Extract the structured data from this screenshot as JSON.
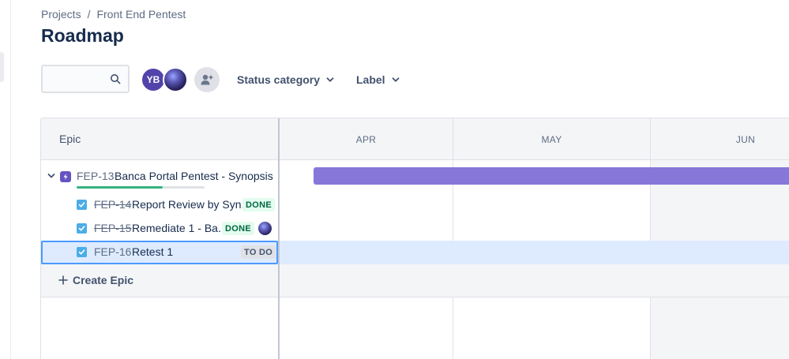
{
  "breadcrumb": {
    "projects": "Projects",
    "separator": "/",
    "project": "Front End Pentest"
  },
  "page": {
    "title": "Roadmap"
  },
  "search": {
    "placeholder": "",
    "value": ""
  },
  "avatars": {
    "yb_initials": "YB"
  },
  "filters": {
    "status_category": "Status category",
    "label": "Label"
  },
  "roadmap": {
    "epic_column_header": "Epic",
    "months": [
      "APR",
      "MAY",
      "JUN"
    ],
    "epic": {
      "key": "FEP-13",
      "summary": "Banca Portal Pentest - Synopsis",
      "progress_done_fraction": 0.67,
      "bar_color": "#8777d9"
    },
    "children": [
      {
        "key": "FEP-14",
        "summary": "Report Review by Syn...",
        "status": "DONE"
      },
      {
        "key": "FEP-15",
        "summary": "Remediate 1 - Ba...",
        "status": "DONE"
      },
      {
        "key": "FEP-16",
        "summary": "Retest 1",
        "status": "TO DO"
      }
    ],
    "create_epic_label": "Create Epic"
  },
  "colors": {
    "accent": "#0052cc",
    "epic_purple": "#6554c0",
    "done_green": "#36b37e",
    "story_blue": "#4bade8",
    "selected_row": "#deebff"
  },
  "icons": [
    "search-icon",
    "add-person-icon",
    "chevron-down-icon",
    "epic-icon",
    "checkbox-icon",
    "plus-icon"
  ]
}
